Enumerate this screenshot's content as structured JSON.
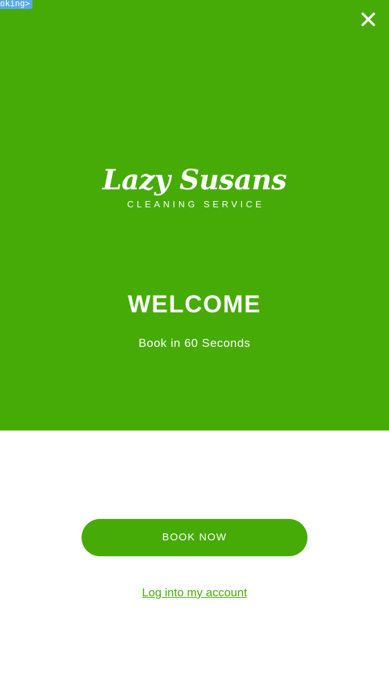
{
  "debug_tag": {
    "label": "oking>"
  },
  "header": {
    "close_icon": "close-icon"
  },
  "logo": {
    "script_text": "Lazy Susans",
    "subtitle": "CLEANING SERVICE"
  },
  "hero": {
    "title": "WELCOME",
    "subtitle": "Book in 60 Seconds"
  },
  "actions": {
    "book_label": "BOOK NOW",
    "login_label": "Log into my account"
  },
  "colors": {
    "brand_green": "#46ab07",
    "background": "#ffffff",
    "text_on_brand": "#ffffff",
    "debug_tag": "#5aa9e6"
  }
}
